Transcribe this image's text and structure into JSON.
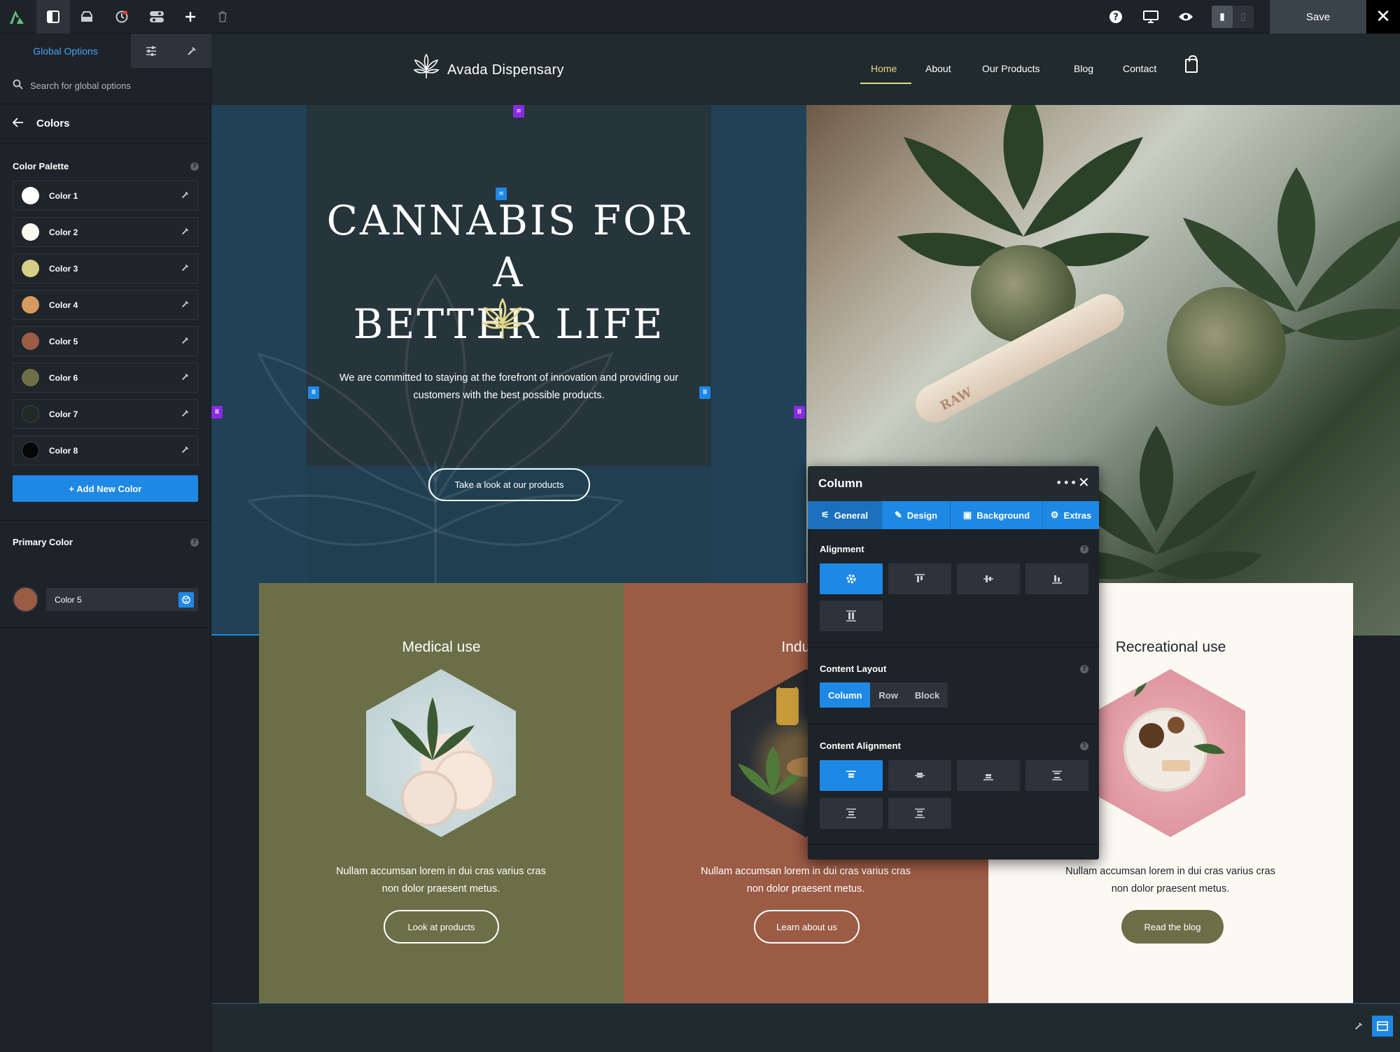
{
  "toolbar": {
    "logo_icon": "avada-logo-icon",
    "buttons": [
      "sidebar-toggle-icon",
      "library-icon",
      "history-icon",
      "toggles-icon",
      "add-icon",
      "trash-icon"
    ],
    "right_icons": [
      "help-icon",
      "desktop-icon",
      "preview-eye-icon"
    ],
    "save_label": "Save",
    "close_glyph": "✕"
  },
  "sidebar": {
    "tabs": {
      "global": "Global Options"
    },
    "search": {
      "placeholder": "Search for global options"
    },
    "section_title": "Colors",
    "palette_label": "Color Palette",
    "colors": [
      {
        "label": "Color 1",
        "hex": "#ffffff"
      },
      {
        "label": "Color 2",
        "hex": "#fbf8ef"
      },
      {
        "label": "Color 3",
        "hex": "#d6cf86"
      },
      {
        "label": "Color 4",
        "hex": "#d49a5e"
      },
      {
        "label": "Color 5",
        "hex": "#9b5b45"
      },
      {
        "label": "Color 6",
        "hex": "#6e6e47"
      },
      {
        "label": "Color 7",
        "hex": "#1f2a26"
      },
      {
        "label": "Color 8",
        "hex": "#060606"
      }
    ],
    "add_color_label": "+ Add New Color",
    "primary_label": "Primary Color",
    "primary_value": "Color 5"
  },
  "site": {
    "brand": "Avada Dispensary",
    "nav": [
      "Home",
      "About",
      "Our Products",
      "Blog",
      "Contact"
    ],
    "hero_title_line1": "CANNABIS FOR A",
    "hero_title_line2": "BETTER LIFE",
    "hero_text_line1": "We are committed to staying at the forefront of innovation and providing our",
    "hero_text_line2": "customers with the best possible products.",
    "hero_cta": "Take a look at our products",
    "photo_brand": "RAW",
    "cards": [
      {
        "title": "Medical use",
        "text1": "Nullam accumsan lorem in dui cras varius cras",
        "text2": "non dolor praesent metus.",
        "button": "Look at products",
        "bg": "#6b6f47"
      },
      {
        "title": "Industr",
        "text1": "Nullam accumsan lorem in dui cras varius cras",
        "text2": "non dolor praesent metus.",
        "button": "Learn about us",
        "bg": "#9b5b45"
      },
      {
        "title": "Recreational use",
        "text1": "Nullam accumsan lorem in dui cras varius cras",
        "text2": "non dolor praesent metus.",
        "button": "Read the blog",
        "bg": "#fcf9f2"
      }
    ]
  },
  "column_panel": {
    "title": "Column",
    "tabs": [
      "General",
      "Design",
      "Background",
      "Extras"
    ],
    "alignment_label": "Alignment",
    "content_layout_label": "Content Layout",
    "content_layout_options": [
      "Column",
      "Row",
      "Block"
    ],
    "content_alignment_label": "Content Alignment"
  },
  "colors": {
    "accent": "#1e88e5",
    "nav_active": "#e3d98d",
    "handle_purple": "#8a2be2"
  }
}
